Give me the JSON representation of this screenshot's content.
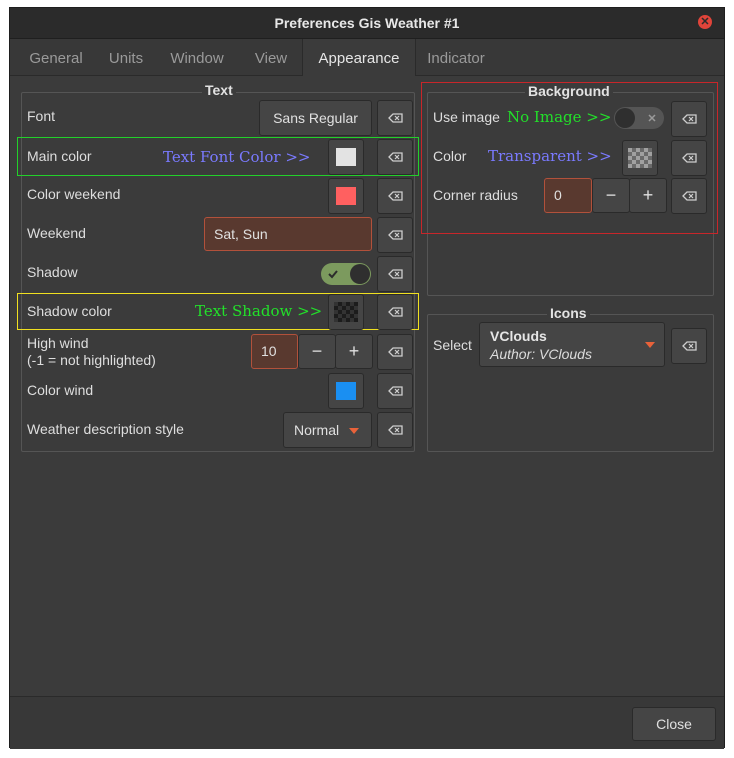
{
  "window": {
    "title": "Preferences Gis Weather #1",
    "close_symbol": "✕"
  },
  "tabs": [
    {
      "label": "General"
    },
    {
      "label": "Units"
    },
    {
      "label": "Window"
    },
    {
      "label": "View"
    },
    {
      "label": "Appearance",
      "active": true
    },
    {
      "label": "Indicator"
    }
  ],
  "text_section": {
    "title": "Text",
    "font_label": "Font",
    "font_value": "Sans Regular",
    "main_color_label": "Main color",
    "main_color_annotation": "Text Font Color >>",
    "main_color": "#e3e3e3",
    "color_weekend_label": "Color weekend",
    "color_weekend": "#ff6060",
    "weekend_label": "Weekend",
    "weekend_value": "Sat, Sun",
    "shadow_label": "Shadow",
    "shadow_on": true,
    "shadow_color_label": "Shadow color",
    "shadow_color_annotation": "Text Shadow >>",
    "shadow_color": "transparent-checker",
    "high_wind_label": "High wind",
    "high_wind_sublabel": "(-1 = not highlighted)",
    "high_wind_value": "10",
    "color_wind_label": "Color wind",
    "color_wind": "#1a8ff2",
    "desc_style_label": "Weather description style",
    "desc_style_value": "Normal"
  },
  "background_section": {
    "title": "Background",
    "use_image_label": "Use image",
    "use_image_annotation": "No Image >>",
    "use_image_on": false,
    "color_label": "Color",
    "color_annotation": "Transparent >>",
    "corner_radius_label": "Corner radius",
    "corner_radius_value": "0"
  },
  "icons_section": {
    "title": "Icons",
    "select_label": "Select",
    "icon_set_name": "VClouds",
    "icon_set_author": "Author: VClouds"
  },
  "footer": {
    "close_label": "Close"
  },
  "symbols": {
    "minus": "−",
    "plus": "+"
  },
  "colors": {
    "annotation_green": "#22e02a",
    "annotation_blue": "#7a7aff",
    "highlight_green": "#22d02a",
    "highlight_yellow": "#f0e020",
    "highlight_red": "#c8262a",
    "accent_orange": "#e8623a"
  },
  "icons": {
    "clear": "clear-backspace-icon",
    "dropdown": "chevron-down-icon",
    "close": "close-icon",
    "check": "check-icon"
  }
}
